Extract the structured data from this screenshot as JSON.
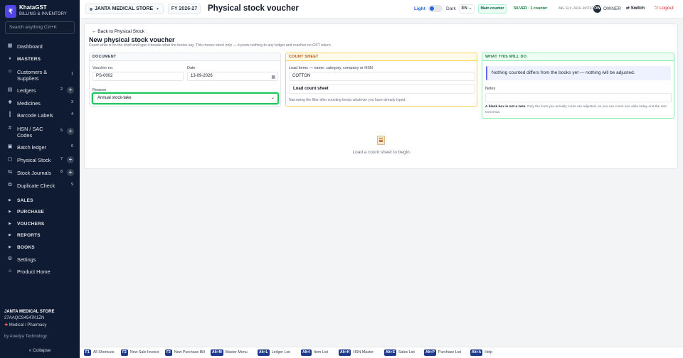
{
  "brand": {
    "logo": "₹",
    "name": "KhataGST",
    "subtitle": "BILLING & INVENTORY"
  },
  "search": {
    "placeholder": "Search anything   Ctrl+K"
  },
  "sidebar": {
    "items": [
      {
        "label": "Dashboard",
        "icon": "dashboard-icon"
      },
      {
        "label": "MASTERS",
        "section": true
      },
      {
        "label": "Customers & Suppliers",
        "count": "1"
      },
      {
        "label": "Ledgers",
        "count": "2",
        "plus": "+"
      },
      {
        "label": "Medicines",
        "count": "3"
      },
      {
        "label": "Barcode Labels",
        "count": "4"
      },
      {
        "label": "HSN / SAC Codes",
        "count": "5",
        "plus": "+"
      },
      {
        "label": "Batch ledger",
        "count": "6"
      },
      {
        "label": "Physical Stock",
        "count": "7",
        "plus": "+"
      },
      {
        "label": "Stock Journals",
        "count": "8",
        "plus": "+"
      },
      {
        "label": "Duplicate Check",
        "count": "9"
      },
      {
        "label": "SALES",
        "section": true
      },
      {
        "label": "PURCHASE",
        "section": true
      },
      {
        "label": "VOUCHERS",
        "section": true
      },
      {
        "label": "REPORTS",
        "section": true
      },
      {
        "label": "BOOKS",
        "section": true
      },
      {
        "label": "Settings"
      },
      {
        "label": "Product Home"
      }
    ],
    "footer": {
      "store": "JANTA MEDICAL STORE",
      "gstin": "27AAQCS4547K1ZN",
      "type": "Medical / Pharmacy",
      "by": "by Anedya Technology",
      "collapse": "« Collapse"
    }
  },
  "topbar": {
    "store": "JANTA MEDICAL STORE",
    "fy": "FY 2026-27",
    "title": "Physical stock voucher",
    "light": "Light",
    "dark": "Dark",
    "lang": "EN ⌄",
    "counter": "Main counter",
    "plan": "SILVER · 1 counter",
    "license": "ANS-SLV-2026-A8TF87",
    "avatar": "OW",
    "role": "OWNER",
    "switch": "⇄ Switch",
    "logout": "⎋ Logout"
  },
  "page": {
    "back": "← Back to Physical Stock",
    "heading": "New physical stock voucher",
    "subtext": "Count what is on the shelf and type it beside what the books say. This moves stock only — it posts nothing to any ledger and reaches no GST return."
  },
  "document": {
    "header": "DOCUMENT",
    "voucher_label": "Voucher no.",
    "voucher_value": "PS-0002",
    "date_label": "Date",
    "date_value": "13-09-2026",
    "reason_label": "Reason",
    "reason_value": "Annual stock-take"
  },
  "count_sheet": {
    "header": "COUNT SHEET",
    "load_label": "Load items — name, category, company or HSN",
    "load_value": "COTTON",
    "button": "Load count sheet",
    "hint": "Narrowing the filter after counting keeps whatever you have already typed."
  },
  "what": {
    "header": "WHAT THIS WILL DO",
    "info": "Nothing counted differs from the books yet — nothing will be adjusted.",
    "notes_label": "Notes",
    "blank_bold": "A blank box is not a zero.",
    "blank_rest": " Only the lines you actually count are adjusted, so you can count one aisle today and the rest tomorrow."
  },
  "empty": {
    "text": "Load a count sheet to begin."
  },
  "shortcuts": [
    {
      "key": "F1",
      "label": "All Shortcuts"
    },
    {
      "key": "F2",
      "label": "New Sale Invoice"
    },
    {
      "key": "F3",
      "label": "New Purchase Bill"
    },
    {
      "key": "Alt+M",
      "label": "Master Menu"
    },
    {
      "key": "Alt+L",
      "label": "Ledger List"
    },
    {
      "key": "Alt+I",
      "label": "Item List"
    },
    {
      "key": "Alt+H",
      "label": "HSN Master"
    },
    {
      "key": "Alt+S",
      "label": "Sales List"
    },
    {
      "key": "Alt+P",
      "label": "Purchase List"
    },
    {
      "key": "Alt+A",
      "label": "Help"
    }
  ],
  "colors": {
    "sidebar": "#0f1b33",
    "accent": "#4f46e5",
    "reason_focus": "#22c55e",
    "count_border": "#fcd34d",
    "what_border": "#86efac",
    "kbd": "#1e3a8a"
  }
}
